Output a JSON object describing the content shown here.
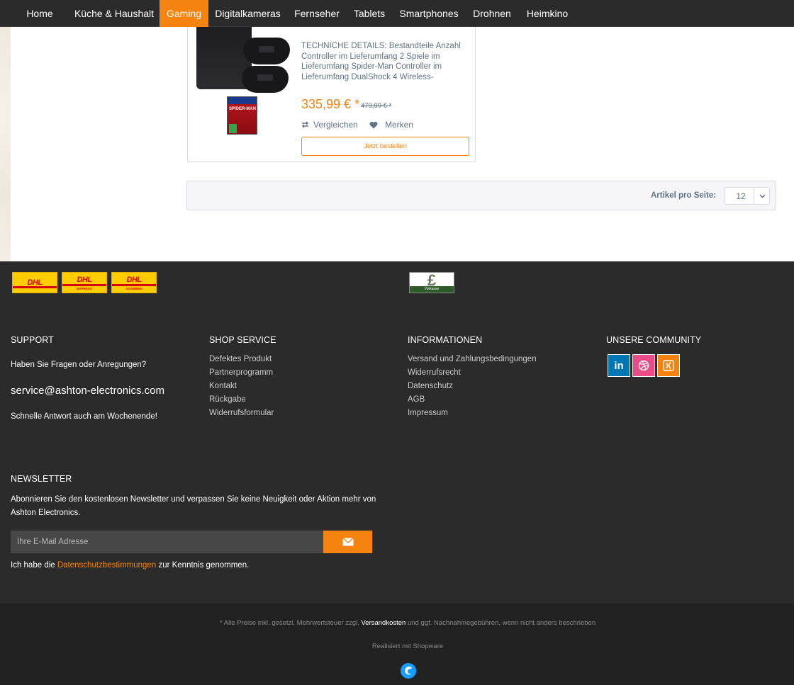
{
  "nav": {
    "items": [
      "Home",
      "Küche & Haushalt",
      "Gaming",
      "Digitalkameras",
      "Fernseher",
      "Tablets",
      "Smartphones",
      "Drohnen",
      "Heimkino"
    ],
    "active": "Gaming"
  },
  "product": {
    "image_game_title": "SPIDER-MAN",
    "description": "TECHNICHE DETAILS: Bestandteile Anzahl Controller im Lieferumfang 2 Spiele im Lieferumfang Spider-Man Controller im Lieferumfang DualShock 4 Wireless-",
    "price": "335,99 € *",
    "old_price": "479,99 € *",
    "compare_label": "Vergleichen",
    "wishlist_label": "Merken",
    "buy_label": "Jetzt bestellen"
  },
  "pagination": {
    "per_page_label": "Artikel pro Seite:",
    "per_page_value": "12"
  },
  "shipping_logos": [
    {
      "word": "DHL",
      "sub": ""
    },
    {
      "word": "DHL",
      "sub": "EXPRESS"
    },
    {
      "word": "DHL",
      "sub": "GOGREEN"
    }
  ],
  "payment": {
    "symbol": "£",
    "label": "Vorkasse"
  },
  "footer": {
    "support": {
      "heading": "SUPPORT",
      "question": "Haben Sie Fragen oder Anregungen?",
      "email": "service@ashton-electronics.com",
      "note": "Schnelle Antwort auch am Wochenende!"
    },
    "shop_service": {
      "heading": "SHOP SERVICE",
      "links": [
        "Defektes Produkt",
        "Partnerprogramm",
        "Kontakt",
        "Rückgabe",
        "Widerrufsformular"
      ]
    },
    "informationen": {
      "heading": "INFORMATIONEN",
      "links": [
        "Versand und Zahlungsbedingungen",
        "Widerrufsrecht",
        "Datenschutz",
        "AGB",
        "Impressum"
      ]
    },
    "community": {
      "heading": "UNSERE COMMUNITY",
      "icons": [
        {
          "name": "linkedin-icon",
          "color": "#0077b5"
        },
        {
          "name": "dribbble-icon",
          "color": "#ea4c89"
        },
        {
          "name": "xing-icon",
          "color": "#f5830f"
        }
      ]
    },
    "newsletter": {
      "heading": "NEWSLETTER",
      "text": "Abonnieren Sie den kostenlosen Newsletter und verpassen Sie keine Neuigkeit oder Aktion mehr von Ashton Electronics.",
      "placeholder": "Ihre E-Mail Adresse",
      "privacy_prefix": "Ich habe die",
      "privacy_link": "Datenschutzbestimmungen",
      "privacy_suffix": "zur Kenntnis genommen."
    },
    "bottom": {
      "note_prefix": "* Alle Preise inkl. gesetzl. Mehrwertsteuer zzgl.",
      "note_link": "Versandkosten",
      "note_suffix": "und ggf. Nachnahmegebühren, wenn nicht anders beschrieben",
      "realized": "Realisiert mit Shopware"
    }
  },
  "colors": {
    "accent": "#f5830f",
    "dark": "#2b2b2b",
    "text_muted": "#5f7285"
  }
}
